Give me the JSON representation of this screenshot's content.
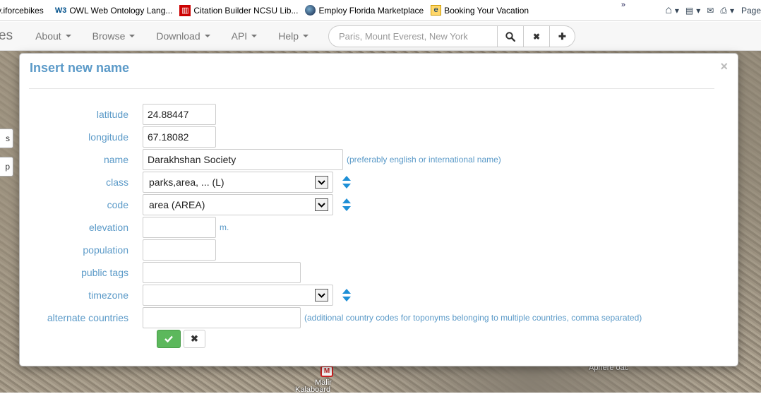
{
  "favorites": [
    {
      "label": "v.iforcebikes",
      "icon": "none"
    },
    {
      "label": "OWL Web Ontology Lang...",
      "icon": "w3c-icon",
      "badge": "W3"
    },
    {
      "label": "Citation Builder  NCSU Lib...",
      "icon": "ncsu-icon"
    },
    {
      "label": "Employ Florida Marketplace",
      "icon": "globe-icon"
    },
    {
      "label": "Booking Your Vacation",
      "icon": "ie-page-icon"
    }
  ],
  "toolbar": {
    "page_label": "Page",
    "more_glyph": "»",
    "home_glyph": "⌂",
    "feed_glyph": "▤",
    "mail_glyph": "✉",
    "print_glyph": "⎙",
    "dropdown_glyph": "▾"
  },
  "navbar": {
    "brand": "es",
    "items": [
      {
        "label": "About"
      },
      {
        "label": "Browse"
      },
      {
        "label": "Download"
      },
      {
        "label": "API"
      },
      {
        "label": "Help"
      }
    ],
    "search": {
      "placeholder": "Paris, Mount Everest, New York",
      "search_glyph": "🔍",
      "clear_glyph": "✖",
      "add_glyph": "✚"
    }
  },
  "map": {
    "btn_1": "s",
    "btn_2": "p",
    "pin_label": "M",
    "label_1": "Malir",
    "label_2": "Kalaboard",
    "label_3": "Apnere oac"
  },
  "modal": {
    "title": "Insert new name",
    "close_glyph": "×",
    "fields": {
      "latitude": {
        "label": "latitude",
        "value": "24.88447"
      },
      "longitude": {
        "label": "longitude",
        "value": "67.18082"
      },
      "name": {
        "label": "name",
        "value": "Darakhshan Society",
        "hint": "(preferably english or international name)"
      },
      "class": {
        "label": "class",
        "value": "parks,area, ... (L)"
      },
      "code": {
        "label": "code",
        "value": "area (AREA)"
      },
      "elevation": {
        "label": "elevation",
        "value": "",
        "unit": "m."
      },
      "population": {
        "label": "population",
        "value": ""
      },
      "public_tags": {
        "label": "public tags",
        "value": ""
      },
      "timezone": {
        "label": "timezone",
        "value": ""
      },
      "alternate_countries": {
        "label": "alternate countries",
        "value": "",
        "hint": "(additional country codes for toponyms belonging to multiple countries, comma separated)"
      }
    },
    "cancel_glyph": "✖"
  },
  "colors": {
    "accent": "#5b9ac8",
    "ok_button": "#5cb85c",
    "sorter": "#1e8fd6"
  }
}
